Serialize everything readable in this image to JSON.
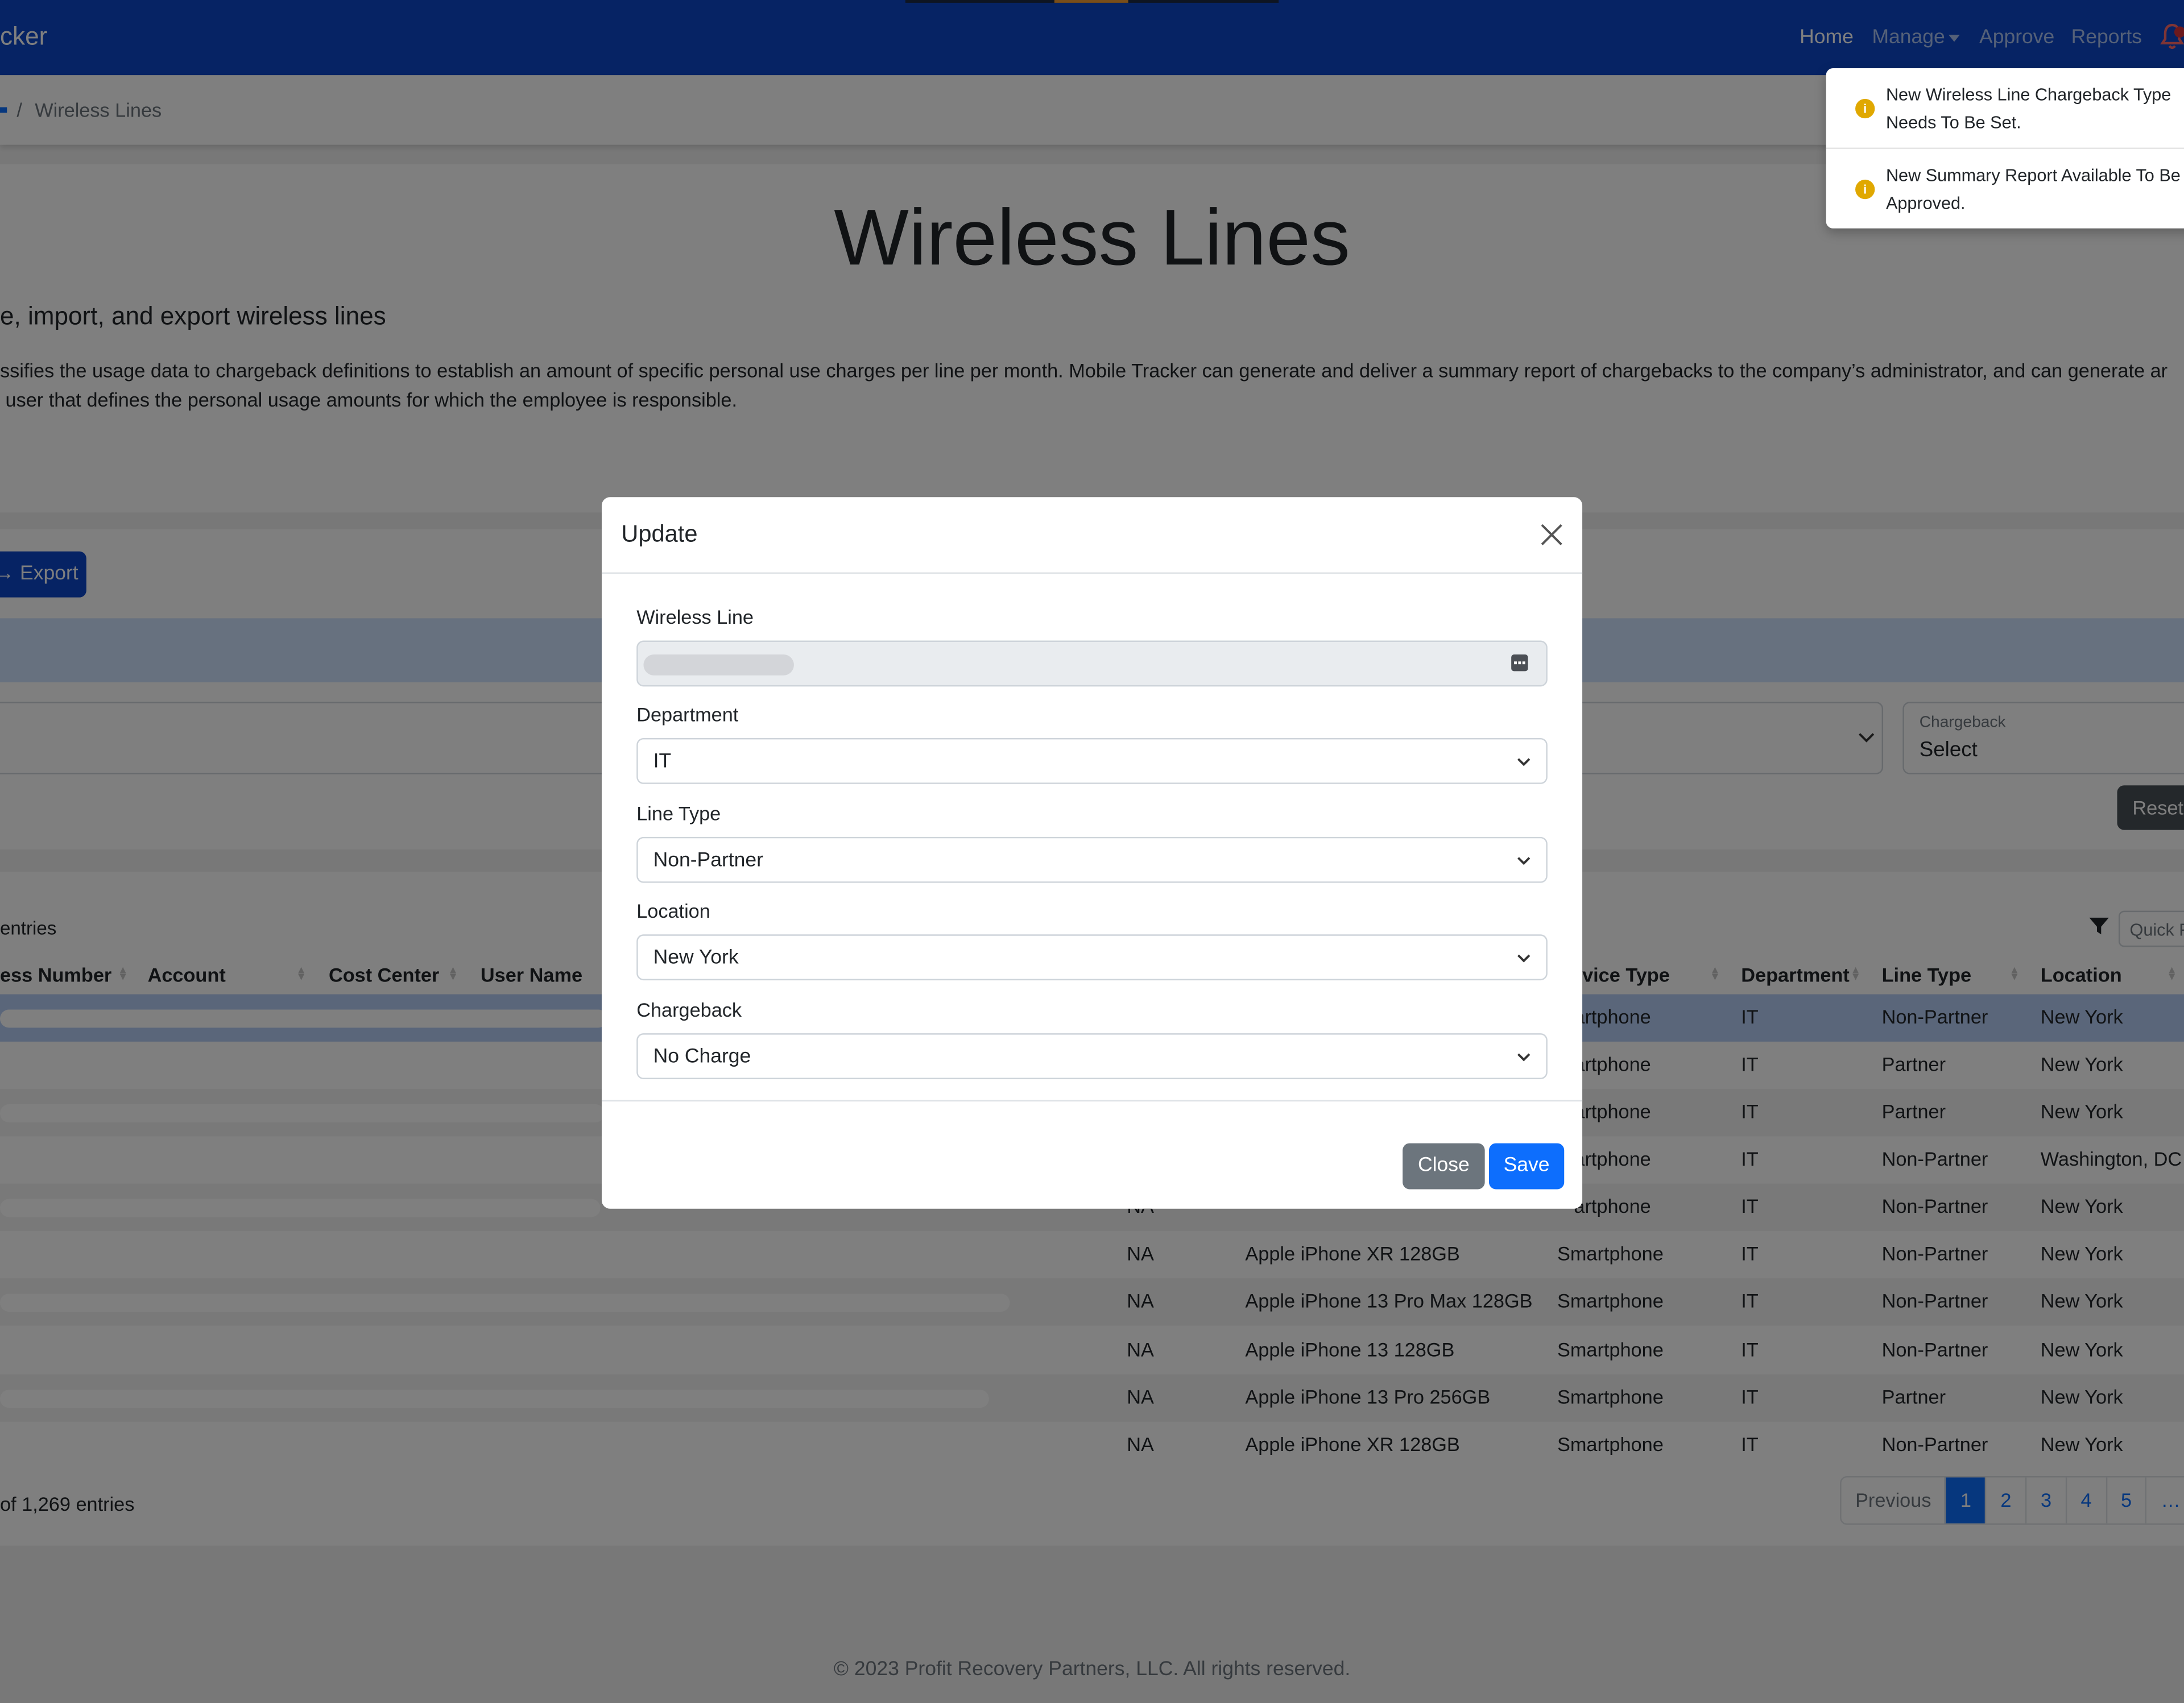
{
  "navbar": {
    "brand": "cker",
    "links": {
      "home": "Home",
      "manage": "Manage",
      "approve": "Approve",
      "reports": "Reports"
    }
  },
  "breadcrumb": {
    "separator": "/",
    "current": "Wireless Lines"
  },
  "header": {
    "title": "Wireless Lines",
    "subtitle": "e, import, and export wireless lines",
    "description": "ssifies the usage data to chargeback definitions to establish an amount of specific personal use charges per line per month. Mobile Tracker can generate and deliver a summary report of chargebacks to the company’s administrator, and can generate ar\n user that defines the personal usage amounts for which the employee is responsible."
  },
  "notifications": [
    {
      "text": "New Wireless Line Chargeback Type Needs To Be Set.",
      "icon": "info-icon"
    },
    {
      "text": "New Summary Report Available To Be Approved.",
      "icon": "info-icon"
    }
  ],
  "toolbar": {
    "export_label": "Export",
    "chargeback_filter": {
      "label": "Chargeback",
      "value": "Select"
    },
    "reset_label": "Reset"
  },
  "table": {
    "entries_label": "entries",
    "quick_filter_placeholder": "Quick F",
    "headers": {
      "number": "ess Number",
      "account": "Account",
      "cost_center": "Cost Center",
      "user_name": "User Name",
      "device_type": "vice Type",
      "department": "Department",
      "line_type": "Line Type",
      "location": "Location"
    },
    "rows": [
      {
        "status": "",
        "device": "",
        "device_type": "artphone",
        "department": "IT",
        "line_type": "Non-Partner",
        "location": "New York"
      },
      {
        "status": "",
        "device": "",
        "device_type": "artphone",
        "department": "IT",
        "line_type": "Partner",
        "location": "New York"
      },
      {
        "status": "",
        "device": "",
        "device_type": "artphone",
        "department": "IT",
        "line_type": "Partner",
        "location": "New York"
      },
      {
        "status": "",
        "device": "",
        "device_type": "artphone",
        "department": "IT",
        "line_type": "Non-Partner",
        "location": "Washington, DC"
      },
      {
        "status": "NA",
        "device": "",
        "device_type": "artphone",
        "department": "IT",
        "line_type": "Non-Partner",
        "location": "New York"
      },
      {
        "status": "NA",
        "device": "Apple iPhone XR 128GB",
        "device_type": "Smartphone",
        "department": "IT",
        "line_type": "Non-Partner",
        "location": "New York"
      },
      {
        "status": "NA",
        "device": "Apple iPhone 13 Pro Max 128GB",
        "device_type": "Smartphone",
        "department": "IT",
        "line_type": "Non-Partner",
        "location": "New York"
      },
      {
        "status": "NA",
        "device": "Apple iPhone 13 128GB",
        "device_type": "Smartphone",
        "department": "IT",
        "line_type": "Non-Partner",
        "location": "New York"
      },
      {
        "status": "NA",
        "device": "Apple iPhone 13 Pro 256GB",
        "device_type": "Smartphone",
        "department": "IT",
        "line_type": "Partner",
        "location": "New York"
      },
      {
        "status": "NA",
        "device": "Apple iPhone XR 128GB",
        "device_type": "Smartphone",
        "department": "IT",
        "line_type": "Non-Partner",
        "location": "New York"
      }
    ],
    "summary": "of 1,269 entries",
    "pagination": {
      "previous": "Previous",
      "pages": [
        "1",
        "2",
        "3",
        "4",
        "5"
      ],
      "ellipsis": "…",
      "active": "1"
    }
  },
  "footer": {
    "text": "© 2023 Profit Recovery Partners, LLC. All rights reserved."
  },
  "modal": {
    "title": "Update",
    "fields": {
      "wireless_line": {
        "label": "Wireless Line",
        "value": ""
      },
      "department": {
        "label": "Department",
        "value": "IT"
      },
      "line_type": {
        "label": "Line Type",
        "value": "Non-Partner"
      },
      "location": {
        "label": "Location",
        "value": "New York"
      },
      "chargeback": {
        "label": "Chargeback",
        "value": "No Charge"
      }
    },
    "close_label": "Close",
    "save_label": "Save"
  },
  "colors": {
    "navbar": "#0d47c9",
    "primary": "#0d6efd",
    "secondary": "#6c757d",
    "warning": "#e0a800",
    "badge": "#d8323b"
  }
}
